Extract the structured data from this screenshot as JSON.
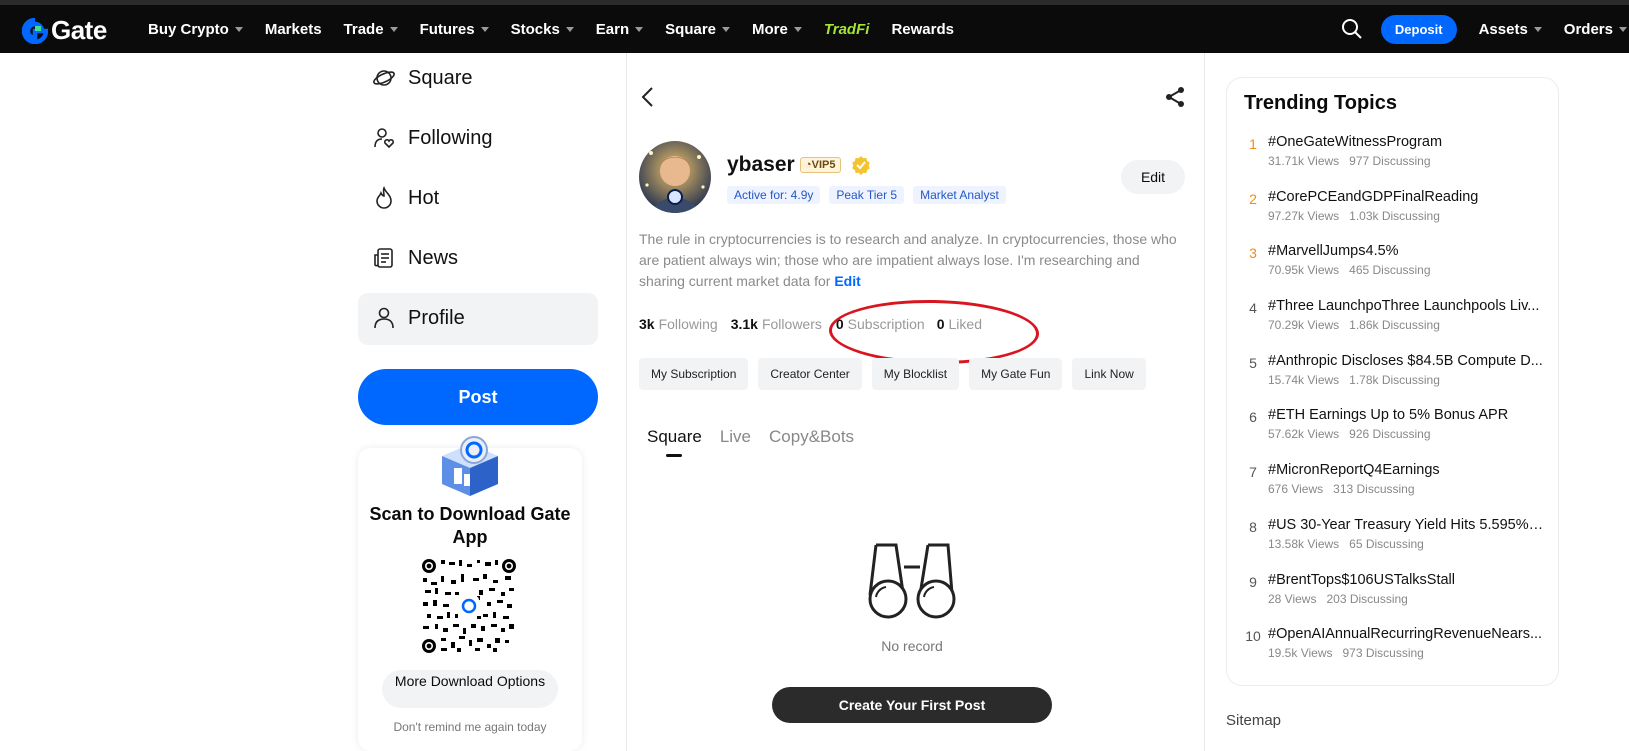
{
  "nav": {
    "logo": "Gate",
    "items": [
      {
        "label": "Buy Crypto",
        "caret": true
      },
      {
        "label": "Markets",
        "caret": false
      },
      {
        "label": "Trade",
        "caret": true
      },
      {
        "label": "Futures",
        "caret": true
      },
      {
        "label": "Stocks",
        "caret": true
      },
      {
        "label": "Earn",
        "caret": true
      },
      {
        "label": "Square",
        "caret": true
      },
      {
        "label": "More",
        "caret": true
      }
    ],
    "tradfi": "TradFi",
    "rewards": "Rewards",
    "deposit": "Deposit",
    "assets": "Assets",
    "orders": "Orders"
  },
  "sidebar": {
    "items": [
      {
        "label": "Square",
        "icon": "planet-icon"
      },
      {
        "label": "Following",
        "icon": "user-heart-icon"
      },
      {
        "label": "Hot",
        "icon": "flame-icon"
      },
      {
        "label": "News",
        "icon": "newspaper-icon"
      },
      {
        "label": "Profile",
        "icon": "user-icon"
      }
    ],
    "post": "Post",
    "download": {
      "title": "Scan to Download Gate App",
      "more": "More Download Options",
      "dismiss": "Don't remind me again today"
    }
  },
  "profile": {
    "username": "ybaser",
    "vip": "VIP5",
    "tags": [
      "Active for: 4.9y",
      "Peak Tier 5",
      "Market Analyst"
    ],
    "edit": "Edit",
    "bio": "The rule in cryptocurrencies is to research and analyze. In cryptocurrencies, those who are patient always win; those who are impatient always lose. I'm researching and sharing current market data for ",
    "bio_edit": "Edit",
    "stats": [
      {
        "value": "3k",
        "label": "Following"
      },
      {
        "value": "3.1k",
        "label": "Followers"
      },
      {
        "value": "0",
        "label": "Subscription"
      },
      {
        "value": "0",
        "label": "Liked"
      }
    ],
    "actions": [
      "My Subscription",
      "Creator Center",
      "My Blocklist",
      "My Gate Fun",
      "Link Now"
    ],
    "tabs": [
      "Square",
      "Live",
      "Copy&Bots"
    ],
    "empty": "No record",
    "create": "Create Your First Post"
  },
  "trending": {
    "title": "Trending Topics",
    "topics": [
      {
        "rank": "1",
        "name": "#OneGateWitnessProgram",
        "views": "31.71k Views",
        "discussing": "977 Discussing"
      },
      {
        "rank": "2",
        "name": "#CorePCEandGDPFinalReading",
        "views": "97.27k Views",
        "discussing": "1.03k Discussing"
      },
      {
        "rank": "3",
        "name": "#MarvellJumps4.5%",
        "views": "70.95k Views",
        "discussing": "465 Discussing"
      },
      {
        "rank": "4",
        "name": "#Three LaunchpoThree Launchpools Liv...",
        "views": "70.29k Views",
        "discussing": "1.86k Discussing"
      },
      {
        "rank": "5",
        "name": "#Anthropic Discloses $84.5B Compute D...",
        "views": "15.74k Views",
        "discussing": "1.78k Discussing"
      },
      {
        "rank": "6",
        "name": "#ETH Earnings Up to 5% Bonus APR",
        "views": "57.62k Views",
        "discussing": "926 Discussing"
      },
      {
        "rank": "7",
        "name": "#MicronReportQ4Earnings",
        "views": "676 Views",
        "discussing": "313 Discussing"
      },
      {
        "rank": "8",
        "name": "#US 30-Year Treasury Yield Hits 5.595%, ...",
        "views": "13.58k Views",
        "discussing": "65 Discussing"
      },
      {
        "rank": "9",
        "name": "#BrentTops$106USTalksStall",
        "views": "28 Views",
        "discussing": "203 Discussing"
      },
      {
        "rank": "10",
        "name": "#OpenAIAnnualRecurringRevenueNears...",
        "views": "19.5k Views",
        "discussing": "973 Discussing"
      }
    ],
    "sitemap": "Sitemap"
  },
  "colors": {
    "accent": "#0068ff",
    "highlight": "#d9151f",
    "rank_top": "#f08c1c"
  }
}
